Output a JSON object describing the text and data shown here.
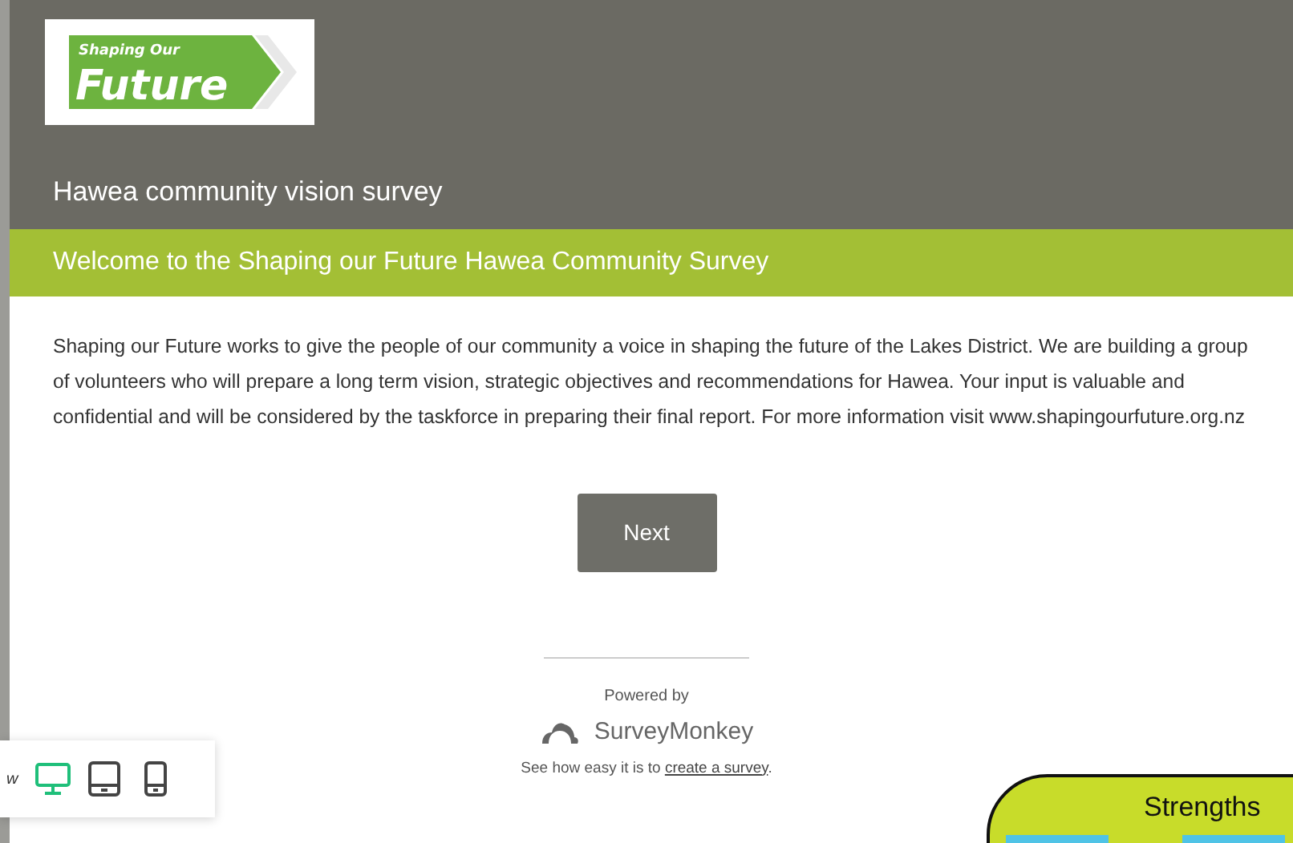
{
  "header": {
    "logo": {
      "small": "Shaping Our",
      "big": "Future"
    },
    "title": "Hawea community vision survey"
  },
  "page_title": "Welcome to the Shaping our Future Hawea Community Survey",
  "intro": "Shaping our Future works to give the people of our community a voice in shaping the future of the Lakes District. We are building a group of volunteers who will prepare a long term vision, strategic objectives and recommendations for Hawea.  Your input is valuable and confidential and will be considered by the taskforce in preparing their final report. For more information visit www.shapingourfuture.org.nz",
  "next_button": "Next",
  "footer": {
    "powered_by": "Powered by",
    "brand": "SurveyMonkey",
    "promo": "See how easy it is to ",
    "promo_link": "create a survey",
    "promo_end": "."
  },
  "preview_toolbar": {
    "cut_label": "w",
    "devices": [
      {
        "kind": "desktop",
        "selected": true
      },
      {
        "kind": "tablet",
        "selected": false
      },
      {
        "kind": "phone",
        "selected": false
      }
    ]
  },
  "strengths_card": {
    "title": "Strengths"
  }
}
